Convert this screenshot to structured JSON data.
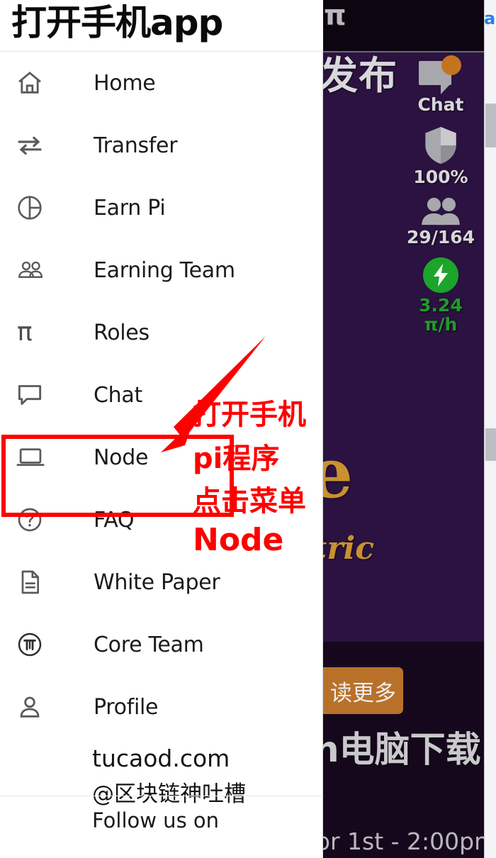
{
  "drawer": {
    "title": "打开手机app",
    "menu_items": [
      {
        "label": "Home",
        "icon": "home-icon"
      },
      {
        "label": "Transfer",
        "icon": "transfer-arrows-icon"
      },
      {
        "label": "Earn Pi",
        "icon": "pie-chart-icon"
      },
      {
        "label": "Earning Team",
        "icon": "people-group-icon"
      },
      {
        "label": "Roles",
        "icon": "pi-symbol-icon"
      },
      {
        "label": "Chat",
        "icon": "chat-bubble-icon"
      },
      {
        "label": "Node",
        "icon": "laptop-icon"
      },
      {
        "label": "FAQ",
        "icon": "question-circle-icon"
      },
      {
        "label": "White Paper",
        "icon": "document-icon"
      },
      {
        "label": "Core Team",
        "icon": "pi-coin-icon"
      },
      {
        "label": "Profile",
        "icon": "person-icon"
      }
    ],
    "follow_text": "Follow us on",
    "roles_pi_glyph": "π"
  },
  "watermark": {
    "site": "tucaod.com",
    "handle": "@区块链神吐槽"
  },
  "annotation": {
    "line1": "打开手机",
    "line2": "pi程序",
    "line3": "点击菜单",
    "line4": "Node",
    "color": "#FE0000",
    "highlight_target": "Node"
  },
  "app_panel": {
    "topbar_glyph": "π",
    "headline": "发布",
    "background_color": "#2B1240",
    "stats": [
      {
        "name": "chat",
        "label": "Chat",
        "icon": "chat-bubble-icon",
        "badge": true,
        "color": "#D7D7D9"
      },
      {
        "name": "security",
        "label": "100%",
        "icon": "shield-icon",
        "badge": false,
        "color": "#D7D7D9"
      },
      {
        "name": "team",
        "label": "29/164",
        "icon": "people-group-icon",
        "badge": false,
        "color": "#D7D7D9"
      },
      {
        "name": "rate_value",
        "label": "3.24",
        "icon": "lightning-bolt-icon",
        "badge": false,
        "color": "#1F9B28"
      },
      {
        "name": "rate_unit",
        "label": "π/h",
        "icon": "",
        "badge": false,
        "color": "#1F9B28"
      }
    ],
    "gold_fragment_large": "e",
    "gold_fragment_italic": "tric",
    "read_more_label": "读更多",
    "download_text": "n电脑下载",
    "event_time": "pr 1st - 2:00pm",
    "badge_color": "#C4741F",
    "button_color": "#B9712A",
    "accent_gold": "#C9912F",
    "accent_green": "#1CA42B"
  },
  "browser_strip": {
    "glyph": "a"
  }
}
